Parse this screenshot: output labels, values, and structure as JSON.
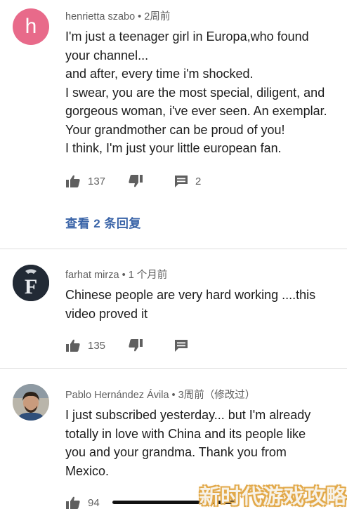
{
  "comments": [
    {
      "avatar_letter": "h",
      "author": "henrietta szabo",
      "time": "2周前",
      "lines": [
        "I'm just a teenager girl in Europa,who found",
        "your channel...",
        "and after, every time i'm shocked.",
        "I swear, you are the most special, diligent, and",
        "gorgeous woman, i've ever seen. An exemplar.",
        "Your grandmother can be proud of you!",
        "I think, I'm just your little european fan."
      ],
      "likes": "137",
      "replies_count": "2",
      "view_replies": "查看 2 条回复"
    },
    {
      "avatar_letter": "F",
      "author": "farhat mirza",
      "time": "1 个月前",
      "lines": [
        "Chinese people are very hard working ....this",
        "video proved it"
      ],
      "likes": "135"
    },
    {
      "author": "Pablo Hernández Ávila",
      "time": "3周前（修改过）",
      "lines": [
        "I just subscribed yesterday... but I'm already",
        "totally in love with China and its people like",
        "you and your grandma. Thank you from",
        "Mexico."
      ],
      "likes": "94"
    }
  ],
  "separator": " • ",
  "watermark": "新时代游戏攻略",
  "icons": {
    "like": "thumbs-up-icon",
    "dislike": "thumbs-down-icon",
    "reply": "reply-comment-icon"
  },
  "colors": {
    "avatar_h": "#e86a8a",
    "link": "#3a64a8",
    "meta": "#606060",
    "watermark_outline": "#e2a94a"
  }
}
